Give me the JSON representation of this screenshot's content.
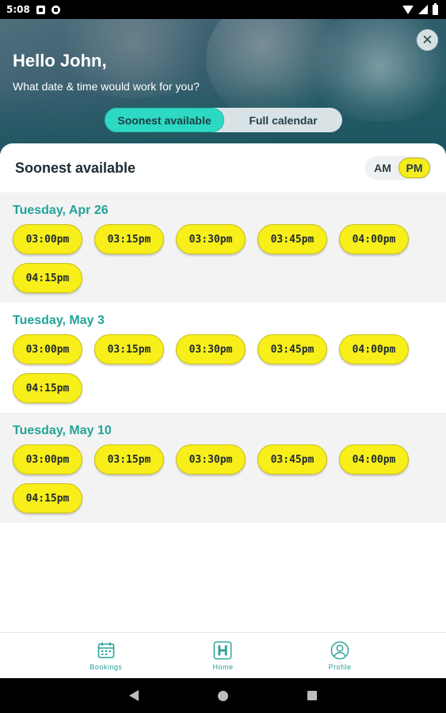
{
  "status_bar": {
    "time": "5:08"
  },
  "header": {
    "greeting": "Hello John,",
    "subtitle": "What date & time would work for you?",
    "toggle": {
      "active": "Soonest available",
      "inactive": "Full calendar"
    }
  },
  "panel": {
    "title": "Soonest available",
    "am_label": "AM",
    "pm_label": "PM",
    "selected_period": "PM"
  },
  "days": [
    {
      "label": "Tuesday, Apr 26",
      "slots": [
        "03:00pm",
        "03:15pm",
        "03:30pm",
        "03:45pm",
        "04:00pm",
        "04:15pm"
      ]
    },
    {
      "label": "Tuesday, May 3",
      "slots": [
        "03:00pm",
        "03:15pm",
        "03:30pm",
        "03:45pm",
        "04:00pm",
        "04:15pm"
      ]
    },
    {
      "label": "Tuesday, May 10",
      "slots": [
        "03:00pm",
        "03:15pm",
        "03:30pm",
        "03:45pm",
        "04:00pm",
        "04:15pm"
      ]
    }
  ],
  "bottom_nav": {
    "items": [
      {
        "label": "Bookings",
        "icon": "calendar-icon"
      },
      {
        "label": "Home",
        "icon": "home-h-icon"
      },
      {
        "label": "Profile",
        "icon": "profile-icon"
      }
    ]
  },
  "colors": {
    "accent_teal": "#2ed9c3",
    "slot_yellow": "#f7ee1a",
    "day_title": "#23a39a"
  }
}
